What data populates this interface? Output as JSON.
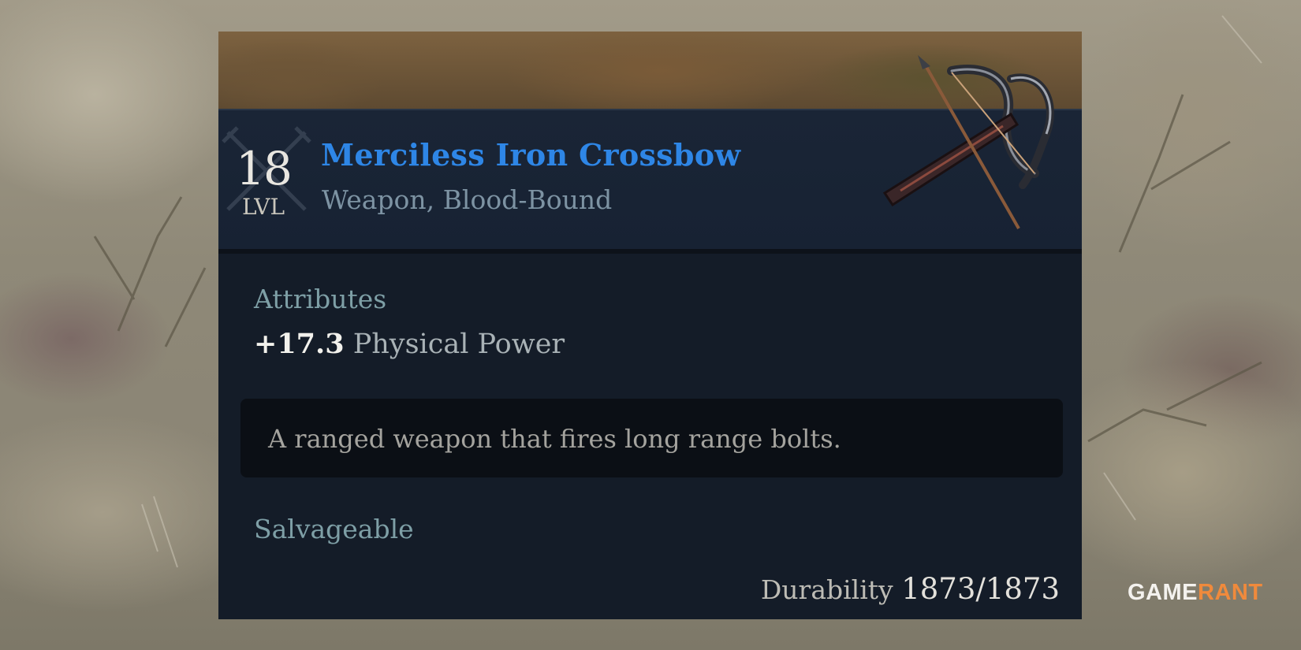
{
  "item": {
    "level": "18",
    "level_label": "LVL",
    "name": "Merciless Iron Crossbow",
    "type": "Weapon, Blood-Bound",
    "icon": "crossbow-icon"
  },
  "attributes": {
    "heading": "Attributes",
    "stats": [
      {
        "value": "+17.3",
        "label": "Physical Power"
      }
    ]
  },
  "description": "A ranged weapon that fires long range bolts.",
  "salvage_text": "Salvageable",
  "durability": {
    "label": "Durability",
    "value": "1873/1873"
  },
  "watermark": {
    "part1": "GAME",
    "part2": "RANT"
  },
  "colors": {
    "item_name": "#2e86e6",
    "panel_bg": "#141c28",
    "header_bg": "#1a2536",
    "section_heading": "#7e9fa6"
  }
}
